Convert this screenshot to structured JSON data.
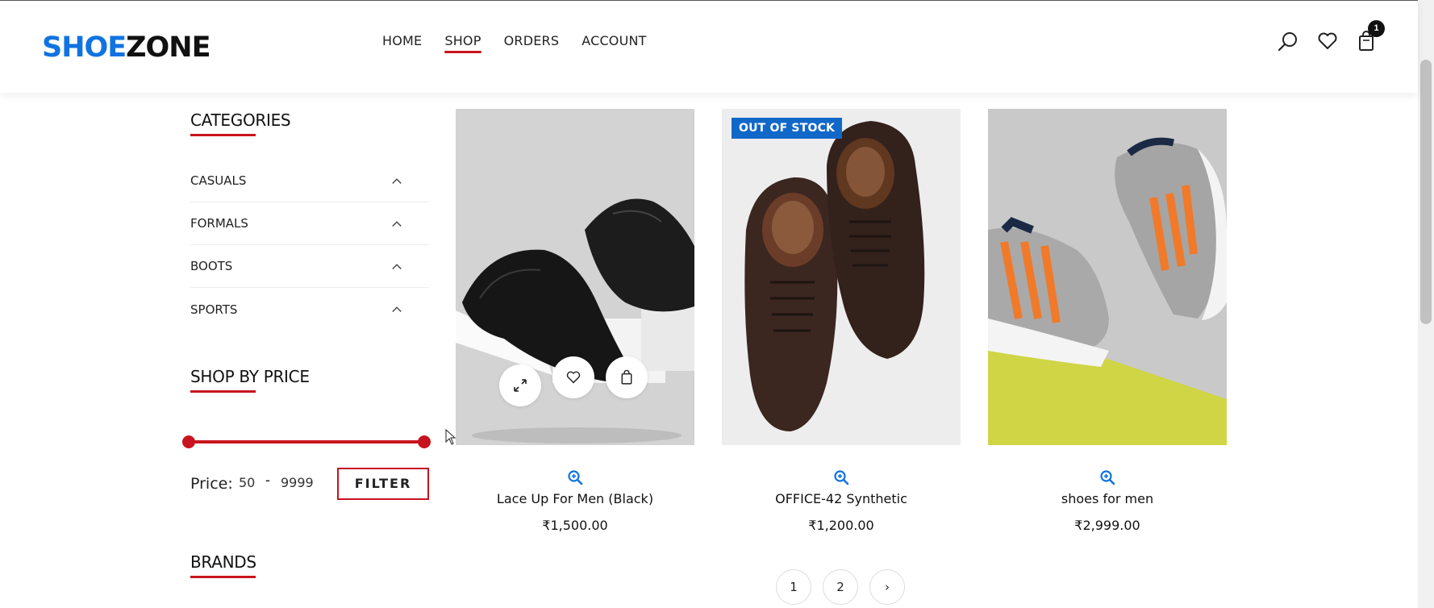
{
  "logo": {
    "part1": "SHOE",
    "part2": "ZONE"
  },
  "nav": [
    {
      "label": "HOME",
      "active": false
    },
    {
      "label": "SHOP",
      "active": true
    },
    {
      "label": "ORDERS",
      "active": false
    },
    {
      "label": "ACCOUNT",
      "active": false
    }
  ],
  "header_icons": {
    "search": "search-icon",
    "wishlist": "heart-icon",
    "cart": "shopping-bag-icon",
    "cart_count": "1"
  },
  "sidebar": {
    "categories_title": "CATEGORIES",
    "categories": [
      {
        "label": "CASUALS",
        "icon": "chevron-up-icon"
      },
      {
        "label": "FORMALS",
        "icon": "chevron-up-icon"
      },
      {
        "label": "BOOTS",
        "icon": "chevron-up-icon"
      },
      {
        "label": "SPORTS",
        "icon": "chevron-up-icon"
      }
    ],
    "price_title": "SHOP BY PRICE",
    "price_label": "Price:",
    "price_min": "50",
    "price_sep": "-",
    "price_max": "9999",
    "filter_label": "FILTER",
    "brands_title": "BRANDS"
  },
  "products": [
    {
      "name": "Lace Up For Men (Black)",
      "price": "₹1,500.00",
      "badge": ""
    },
    {
      "name": "OFFICE-42 Synthetic",
      "price": "₹1,200.00",
      "badge": "OUT OF STOCK"
    },
    {
      "name": "shoes for men",
      "price": "₹2,999.00",
      "badge": ""
    }
  ],
  "pagination": {
    "pages": [
      "1",
      "2"
    ],
    "next": "›"
  },
  "colors": {
    "brand_blue": "#1173e0",
    "accent_red": "#c8141e",
    "badge_blue": "#1068c9"
  }
}
